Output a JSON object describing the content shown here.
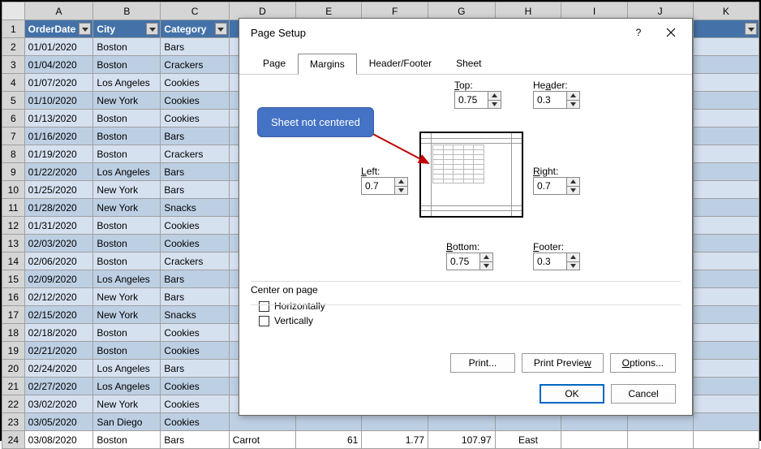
{
  "columns": [
    "A",
    "B",
    "C",
    "D",
    "E",
    "F",
    "G",
    "H",
    "I",
    "J",
    "K"
  ],
  "headers": [
    "OrderDate",
    "City",
    "Category"
  ],
  "rows": [
    [
      "01/01/2020",
      "Boston",
      "Bars"
    ],
    [
      "01/04/2020",
      "Boston",
      "Crackers"
    ],
    [
      "01/07/2020",
      "Los Angeles",
      "Cookies"
    ],
    [
      "01/10/2020",
      "New York",
      "Cookies"
    ],
    [
      "01/13/2020",
      "Boston",
      "Cookies"
    ],
    [
      "01/16/2020",
      "Boston",
      "Bars"
    ],
    [
      "01/19/2020",
      "Boston",
      "Crackers"
    ],
    [
      "01/22/2020",
      "Los Angeles",
      "Bars"
    ],
    [
      "01/25/2020",
      "New York",
      "Bars"
    ],
    [
      "01/28/2020",
      "New York",
      "Snacks"
    ],
    [
      "01/31/2020",
      "Boston",
      "Cookies"
    ],
    [
      "02/03/2020",
      "Boston",
      "Cookies"
    ],
    [
      "02/06/2020",
      "Boston",
      "Crackers"
    ],
    [
      "02/09/2020",
      "Los Angeles",
      "Bars"
    ],
    [
      "02/12/2020",
      "New York",
      "Bars"
    ],
    [
      "02/15/2020",
      "New York",
      "Snacks"
    ],
    [
      "02/18/2020",
      "Boston",
      "Cookies"
    ],
    [
      "02/21/2020",
      "Boston",
      "Cookies"
    ],
    [
      "02/24/2020",
      "Los Angeles",
      "Bars"
    ],
    [
      "02/27/2020",
      "Los Angeles",
      "Cookies"
    ],
    [
      "03/02/2020",
      "New York",
      "Cookies"
    ],
    [
      "03/05/2020",
      "San Diego",
      "Cookies"
    ]
  ],
  "lastRow": [
    "03/08/2020",
    "Boston",
    "Bars",
    "Carrot",
    "61",
    "1.77",
    "107.97",
    "East"
  ],
  "dialog": {
    "title": "Page Setup",
    "tabs": [
      "Page",
      "Margins",
      "Header/Footer",
      "Sheet"
    ],
    "activeTab": 1,
    "margins": {
      "topLabel": "Top:",
      "top": "0.75",
      "headerLabel": "Header:",
      "header": "0.3",
      "leftLabel": "Left:",
      "left": "0.7",
      "rightLabel": "Right:",
      "right": "0.7",
      "bottomLabel": "Bottom:",
      "bottom": "0.75",
      "footerLabel": "Footer:",
      "footer": "0.3"
    },
    "centerTitle": "Center on page",
    "centerH": "Horizontally",
    "centerV": "Vertically",
    "buttons": {
      "print": "Print...",
      "preview": "Print Preview",
      "options": "Options...",
      "ok": "OK",
      "cancel": "Cancel"
    }
  },
  "callout": "Sheet not centered"
}
